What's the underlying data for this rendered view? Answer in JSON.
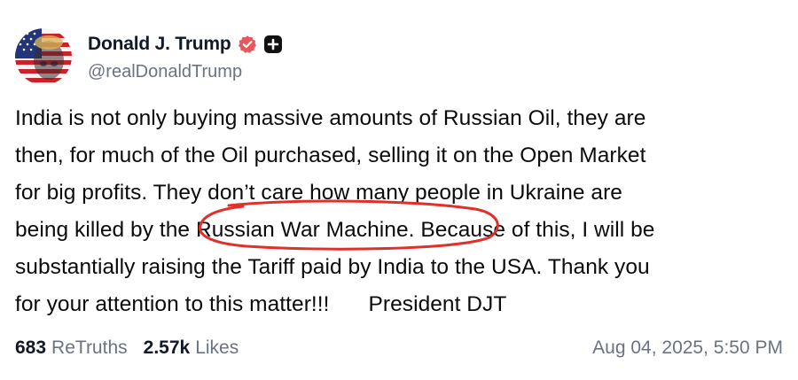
{
  "author": {
    "display_name": "Donald J. Trump",
    "handle": "@realDonaldTrump",
    "avatar_icon": "avatar-flag-face",
    "verified_icon": "verified-badge-icon",
    "verified_color": "#e8575a",
    "plus_icon": "plus-badge-icon"
  },
  "post": {
    "lines": [
      "India is not only buying massive amounts of Russian Oil, they are",
      "then, for much of the Oil purchased, selling it on the Open Market",
      "for big profits. They don’t care how many people in Ukraine are",
      "being killed by the ",
      "Russian War Machine.",
      " Because of this, I will be",
      "substantially raising the Tariff paid by India to the USA. Thank you",
      "for your attention to this matter!!!",
      "President DJT"
    ],
    "annotation_color": "#e0302a"
  },
  "stats": {
    "retruths_count": "683",
    "retruths_label": "ReTruths",
    "likes_count": "2.57k",
    "likes_label": "Likes"
  },
  "timestamp": "Aug 04, 2025, 5:50 PM"
}
